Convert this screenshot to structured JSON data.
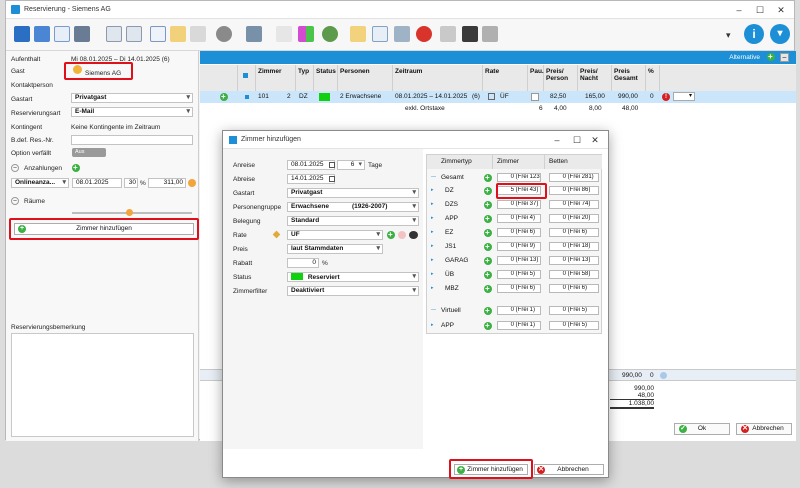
{
  "window": {
    "title": "Reservierung - Siemens AG"
  },
  "form": {
    "aufenthalt_label": "Aufenthalt",
    "aufenthalt_value": "Mi 08.01.2025 – Di 14.01.2025 (6)",
    "gast_label": "Gast",
    "gast_value": "Siemens AG",
    "kontaktperson_label": "Kontaktperson",
    "gastart_label": "Gastart",
    "gastart_value": "Privatgast",
    "reservierungsart_label": "Reservierungsart",
    "reservierungsart_value": "E-Mail",
    "kontingent_label": "Kontingent",
    "kontingent_value": "Keine Kontingente im Zeitraum",
    "bdef_label": "B.def. Res.-Nr.",
    "option_label": "Option verfällt",
    "option_toggle": "Aus",
    "anzahlungen_label": "Anzahlungen",
    "anz_type": "Onlineanza...",
    "anz_date": "08.01.2025",
    "anz_pct": "30",
    "anz_pct_unit": "%",
    "anz_amount": "311,00",
    "raeume_label": "Räume",
    "zimmer_btn": "Zimmer hinzufügen",
    "bemerkung_label": "Reservierungsbemerkung"
  },
  "grid": {
    "alternative_label": "Alternative",
    "headers": [
      "Zimmer",
      "Typ",
      "Status",
      "Personen",
      "Zeitraum",
      "Rate",
      "Pau.",
      "Preis/ Person",
      "Preis/ Nacht",
      "Preis Gesamt",
      "%"
    ],
    "row1": {
      "zimmer": "101",
      "typ": "2",
      "typ2": "DZ",
      "personen": "2 Erwachsene",
      "zeitraum": "08.01.2025 – 14.01.2025",
      "nights": "(6)",
      "rate": "ÜF",
      "pp": "82,50",
      "pn": "165,00",
      "pg": "990,00",
      "pct": "0"
    },
    "row2": {
      "zeitraum": "exkl. Ortstaxe",
      "col1": "6",
      "pp": "4,00",
      "pn": "8,00",
      "pg": "48,00"
    },
    "footer": {
      "total": "990,00",
      "pct": "0"
    },
    "summary": [
      "990,00",
      "48,00",
      "1.038,00"
    ]
  },
  "main_buttons": {
    "ok": "Ok",
    "abbrechen": "Abbrechen"
  },
  "dialog": {
    "title": "Zimmer hinzufügen",
    "anreise_label": "Anreise",
    "anreise_value": "08.01.2025",
    "tage_value": "6",
    "tage_label": "Tage",
    "abreise_label": "Abreise",
    "abreise_value": "14.01.2025",
    "gastart_label": "Gastart",
    "gastart_value": "Privatgast",
    "personengruppe_label": "Personengruppe",
    "personengruppe_value": "Erwachsene",
    "personengruppe_range": "(1926-2007)",
    "belegung_label": "Belegung",
    "belegung_value": "Standard",
    "rate_label": "Rate",
    "rate_value": "ÜF",
    "preis_label": "Preis",
    "preis_value": "laut Stammdaten",
    "rabatt_label": "Rabatt",
    "rabatt_value": "0",
    "rabatt_unit": "%",
    "status_label": "Status",
    "status_value": "Reserviert",
    "zimmerfilter_label": "Zimmerfilter",
    "zimmerfilter_value": "Deaktiviert",
    "table_headers": [
      "Zimmertyp",
      "Zimmer",
      "Betten"
    ],
    "rows": [
      {
        "name": "Gesamt",
        "count": "0",
        "frei": "(Frei 123)",
        "bcount": "0",
        "bfrei": "(Frei 281)"
      },
      {
        "name": "DZ",
        "count": "5",
        "frei": "(Frei 43)",
        "bcount": "0",
        "bfrei": "(Frei 86)"
      },
      {
        "name": "DZS",
        "count": "0",
        "frei": "(Frei 37)",
        "bcount": "0",
        "bfrei": "(Frei 74)"
      },
      {
        "name": "APP",
        "count": "0",
        "frei": "(Frei 4)",
        "bcount": "0",
        "bfrei": "(Frei 20)"
      },
      {
        "name": "EZ",
        "count": "0",
        "frei": "(Frei 6)",
        "bcount": "0",
        "bfrei": "(Frei 6)"
      },
      {
        "name": "JS1",
        "count": "0",
        "frei": "(Frei 9)",
        "bcount": "0",
        "bfrei": "(Frei 18)"
      },
      {
        "name": "GARAG",
        "count": "0",
        "frei": "(Frei 13)",
        "bcount": "0",
        "bfrei": "(Frei 13)"
      },
      {
        "name": "ÜB",
        "count": "0",
        "frei": "(Frei 5)",
        "bcount": "0",
        "bfrei": "(Frei 58)"
      },
      {
        "name": "MBZ",
        "count": "0",
        "frei": "(Frei 6)",
        "bcount": "0",
        "bfrei": "(Frei 6)"
      },
      {
        "name": "Virtuell",
        "count": "0",
        "frei": "(Frei 1)",
        "bcount": "0",
        "bfrei": "(Frei 5)"
      },
      {
        "name": "APP",
        "count": "0",
        "frei": "(Frei 1)",
        "bcount": "0",
        "bfrei": "(Frei 5)"
      }
    ],
    "add_btn": "Zimmer hinzufügen",
    "cancel_btn": "Abbrechen"
  }
}
